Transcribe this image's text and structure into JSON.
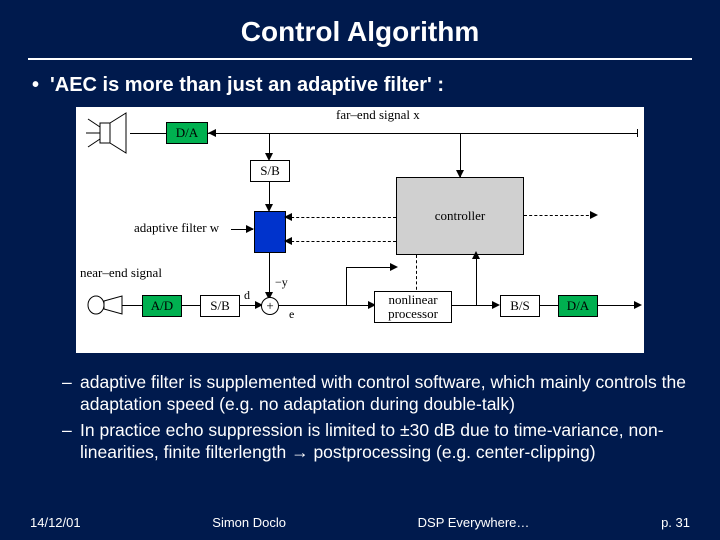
{
  "title": "Control Algorithm",
  "bullet1": "'AEC is more than just an adaptive filter' :",
  "diagram": {
    "da1": "D/A",
    "sb_top": "S/B",
    "farend": "far–end signal x",
    "adaptive_filter": "adaptive filter w",
    "controller": "controller",
    "nearend": "near–end signal",
    "ad": "A/D",
    "sb_bot": "S/B",
    "d": "d",
    "minus_y": "−y",
    "e": "e",
    "plus": "+",
    "nonlinear_l1": "nonlinear",
    "nonlinear_l2": "processor",
    "bs": "B/S",
    "da2": "D/A"
  },
  "sub": [
    "adaptive filter is supplemented with control software, which mainly controls the adaptation speed (e.g. no adaptation during double-talk)",
    "In practice echo suppression is limited to ±30 dB due to time-variance, non-linearities, finite filterlength → postprocessing (e.g. center-clipping)"
  ],
  "footer": {
    "date": "14/12/01",
    "author": "Simon Doclo",
    "series": "DSP Everywhere…",
    "page": "p. 31"
  }
}
